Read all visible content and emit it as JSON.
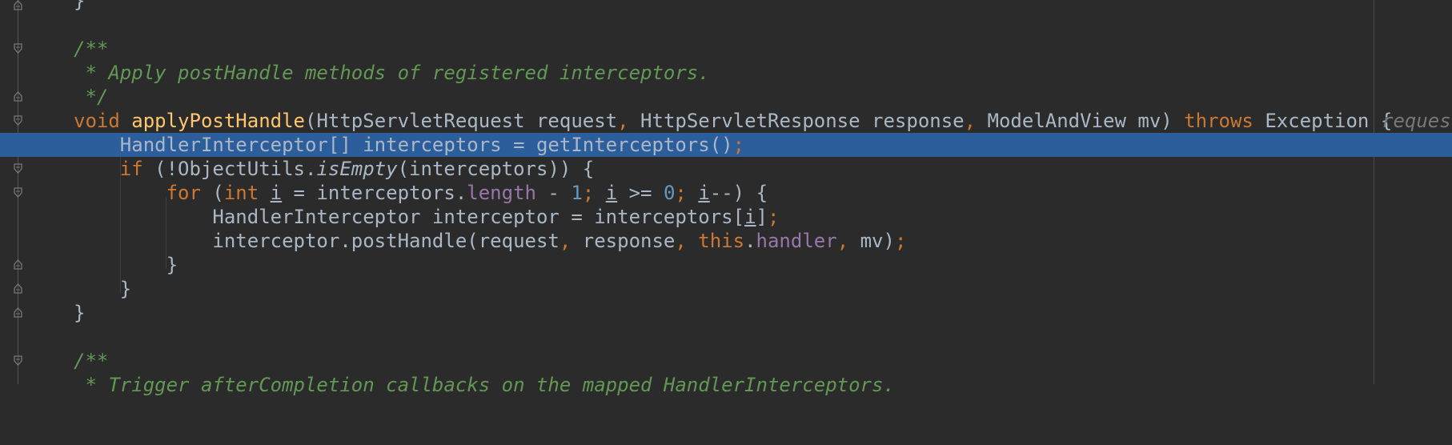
{
  "editor": {
    "lines": {
      "l0": "}",
      "l2": "/**",
      "l3": " * Apply postHandle methods of registered interceptors.",
      "l4": " */",
      "l5": {
        "kw_void": "void ",
        "method": "applyPostHandle",
        "p1": "(HttpServletRequest request",
        "c1": ", ",
        "p2": "HttpServletResponse response",
        "c2": ", ",
        "p3": "ModelAndView mv) ",
        "kw_throws": "throws ",
        "exc": "Exception {",
        "hint": "request"
      },
      "l6": {
        "a": "    HandlerInterceptor[] interceptors = getInterceptors()",
        "semi": ";"
      },
      "l7": {
        "kw_if": "    if ",
        "a": "(!ObjectUtils.",
        "italic": "isEmpty",
        "b": "(interceptors)) {"
      },
      "l8": {
        "kw_for": "        for ",
        "a": "(",
        "kw_int": "int ",
        "var_i1": "i",
        "b": " = interceptors.",
        "field": "length",
        "c": " - ",
        "num1": "1",
        "s1": "; ",
        "var_i2": "i",
        "d": " >= ",
        "num2": "0",
        "s2": "; ",
        "var_i3": "i",
        "e": "--) {"
      },
      "l9": {
        "a": "            HandlerInterceptor interceptor = interceptors[",
        "var_i": "i",
        "b": "]",
        "semi": ";"
      },
      "l10": {
        "a": "            interceptor.postHandle(request",
        "c1": ", ",
        "b": "response",
        "c2": ", ",
        "kw_this": "this",
        "dot": ".",
        "field": "handler",
        "c3": ", ",
        "d": "mv)",
        "semi": ";"
      },
      "l11": "        }",
      "l12": "    }",
      "l13": "}",
      "l15": "/**",
      "l16": " * Trigger afterCompletion callbacks on the mapped HandlerInterceptors."
    }
  },
  "colors": {
    "background": "#2b2b2b",
    "selection": "#2d5e9c",
    "keyword": "#cc7832",
    "method": "#ffc66d",
    "doc_comment": "#629755",
    "number": "#6897bb",
    "field": "#9876aa",
    "text": "#a9b7c6"
  },
  "icons": [
    "fold-open-icon",
    "fold-close-icon"
  ]
}
